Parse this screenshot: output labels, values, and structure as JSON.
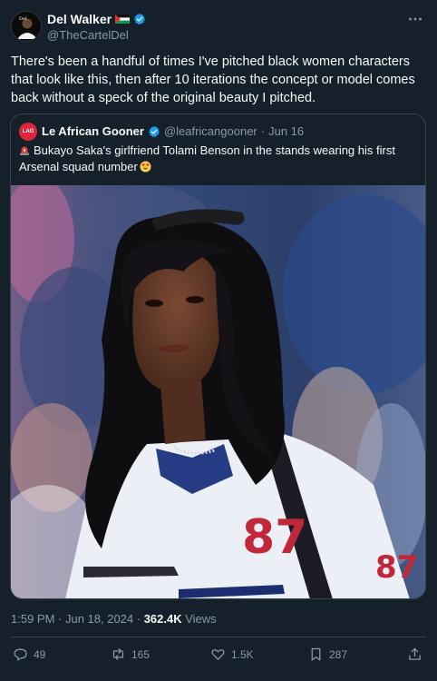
{
  "author": {
    "name": "Del Walker",
    "handle": "@TheCartelDel"
  },
  "tweet_text": "There's been a handful of times I've pitched black women characters that look like this, then after 10 iterations the concept or model comes back without a speck of the original beauty I pitched.",
  "quote": {
    "name": "Le African Gooner",
    "handle": "@leafricangooner",
    "separator": "·",
    "date": "Jun 16",
    "avatar_text": "LAG",
    "text": "Bukayo Saka's girlfriend Tolami Benson in the stands wearing his first Arsenal squad number",
    "jersey_number": "87"
  },
  "meta": {
    "time": "1:59 PM · Jun 18, 2024 · ",
    "views_count": "362.4K",
    "views_label": " Views"
  },
  "actions": {
    "replies": "49",
    "reposts": "165",
    "likes": "1.5K",
    "bookmarks": "287"
  },
  "icons": [
    "verified-icon",
    "flag-icon",
    "more-icon",
    "siren-emoji-icon",
    "heart-eyes-emoji-icon",
    "reply-icon",
    "repost-icon",
    "like-icon",
    "bookmark-icon",
    "share-icon"
  ],
  "colors": {
    "background": "#15202b",
    "text": "#f7f9f9",
    "secondary_text": "#8b98a5",
    "border": "#38444d",
    "verified": "#1d9bf0"
  }
}
